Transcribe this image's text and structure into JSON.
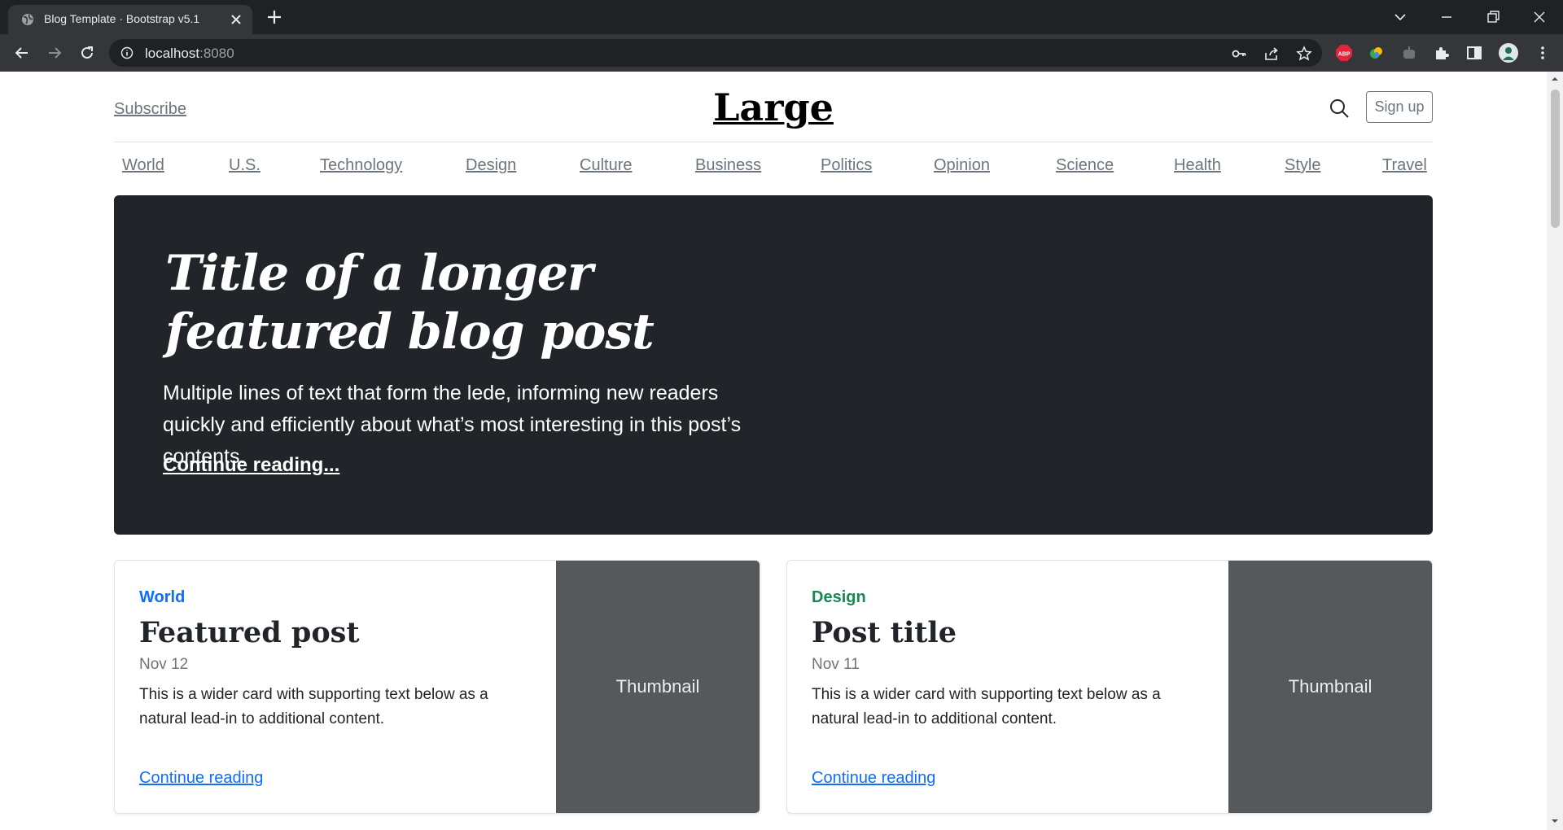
{
  "browser": {
    "tab_title": "Blog Template · Bootstrap v5.1",
    "url_host": "localhost",
    "url_port": ":8080"
  },
  "header": {
    "subscribe": "Subscribe",
    "logo": "Large",
    "signup": "Sign up"
  },
  "nav": [
    "World",
    "U.S.",
    "Technology",
    "Design",
    "Culture",
    "Business",
    "Politics",
    "Opinion",
    "Science",
    "Health",
    "Style",
    "Travel"
  ],
  "hero": {
    "title": "Title of a longer featured blog post",
    "lede": "Multiple lines of text that form the lede, informing new readers quickly and efficiently about what’s most interesting in this post’s contents.",
    "link": "Continue reading..."
  },
  "cards": [
    {
      "category": "World",
      "category_color": "#0d6efd",
      "title": "Featured post",
      "date": "Nov 12",
      "text": "This is a wider card with supporting text below as a natural lead-in to additional content.",
      "link": "Continue reading",
      "thumbnail": "Thumbnail"
    },
    {
      "category": "Design",
      "category_color": "#198754",
      "title": "Post title",
      "date": "Nov 11",
      "text": "This is a wider card with supporting text below as a natural lead-in to additional content.",
      "link": "Continue reading",
      "thumbnail": "Thumbnail"
    }
  ]
}
